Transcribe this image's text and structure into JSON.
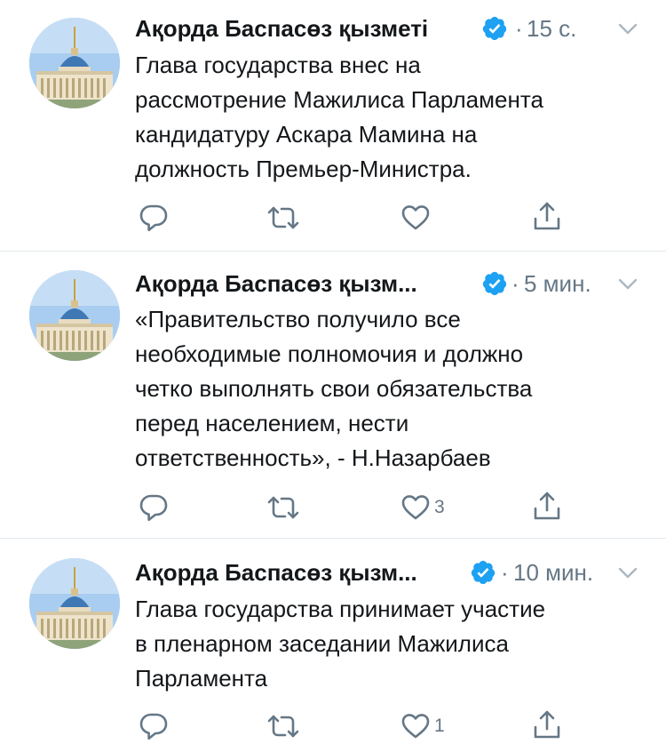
{
  "colors": {
    "verified": "#1da1f2",
    "meta_text": "#657786",
    "divider": "#e1e8ed",
    "icon": "#657786"
  },
  "tweets": [
    {
      "author": "Ақорда Баспасөз қызметі",
      "verified_icon": "verified-badge-icon",
      "separator": "·",
      "time": "15 с.",
      "text_lines": [
        "Глава государства внес на",
        "рассмотрение Мажилиса Парламента",
        "кандидатуру Аскара Мамина на",
        "должность Премьер-Министра."
      ],
      "actions": {
        "reply_count": "",
        "retweet_count": "",
        "like_count": ""
      }
    },
    {
      "author": "Ақорда Баспасөз қызм...",
      "verified_icon": "verified-badge-icon",
      "separator": "·",
      "time": "5 мин.",
      "text_lines": [
        "«Правительство получило все",
        "необходимые полномочия и должно",
        "четко выполнять свои обязательства",
        "перед населением, нести",
        "ответственность», - Н.Назарбаев"
      ],
      "actions": {
        "reply_count": "",
        "retweet_count": "",
        "like_count": "3"
      }
    },
    {
      "author": "Ақорда Баспасөз қызм...",
      "verified_icon": "verified-badge-icon",
      "separator": "·",
      "time": "10 мин.",
      "text_lines": [
        "Глава государства принимает участие",
        "в пленарном заседании Мажилиса",
        "Парламента"
      ],
      "actions": {
        "reply_count": "",
        "retweet_count": "",
        "like_count": "1"
      }
    }
  ]
}
